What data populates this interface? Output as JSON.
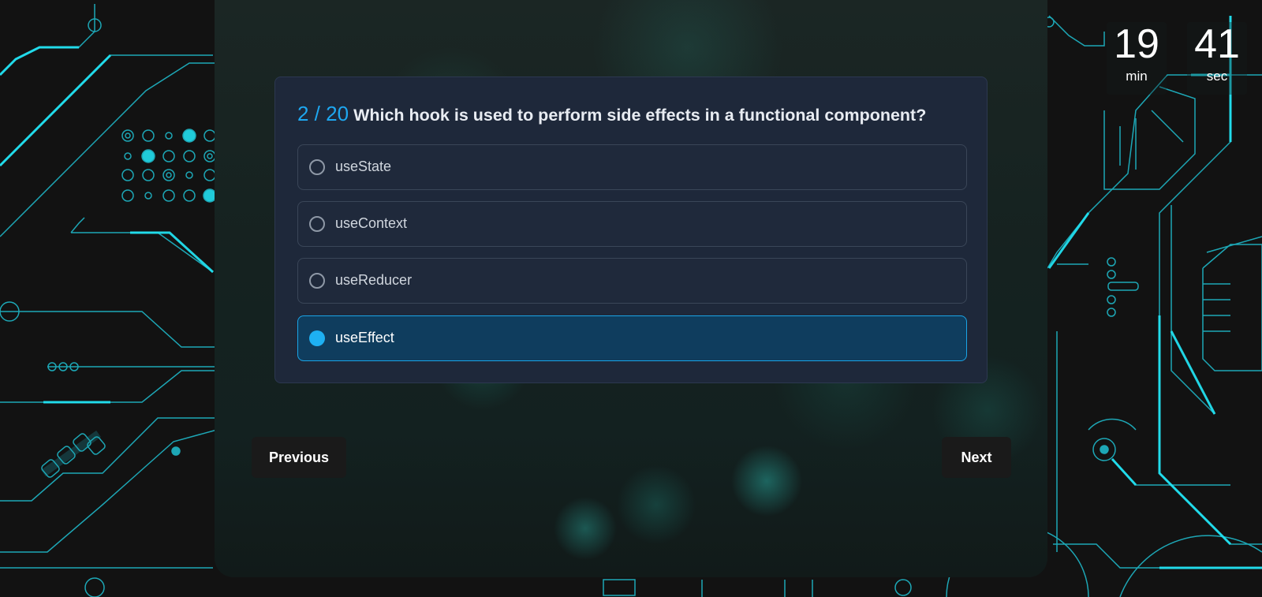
{
  "timer": {
    "minutes": "19",
    "minutes_label": "min",
    "seconds": "41",
    "seconds_label": "sec"
  },
  "quiz": {
    "progress": "2 / 20",
    "question": "Which hook is used to perform side effects in a functional component?",
    "options": [
      {
        "label": "useState",
        "selected": false
      },
      {
        "label": "useContext",
        "selected": false
      },
      {
        "label": "useReducer",
        "selected": false
      },
      {
        "label": "useEffect",
        "selected": true
      }
    ]
  },
  "navigation": {
    "previous_label": "Previous",
    "next_label": "Next"
  },
  "colors": {
    "accent": "#1eb0f2",
    "circuit": "#22d3e6",
    "card_bg": "#1e283a",
    "selected_bg": "#0f3d5e"
  }
}
